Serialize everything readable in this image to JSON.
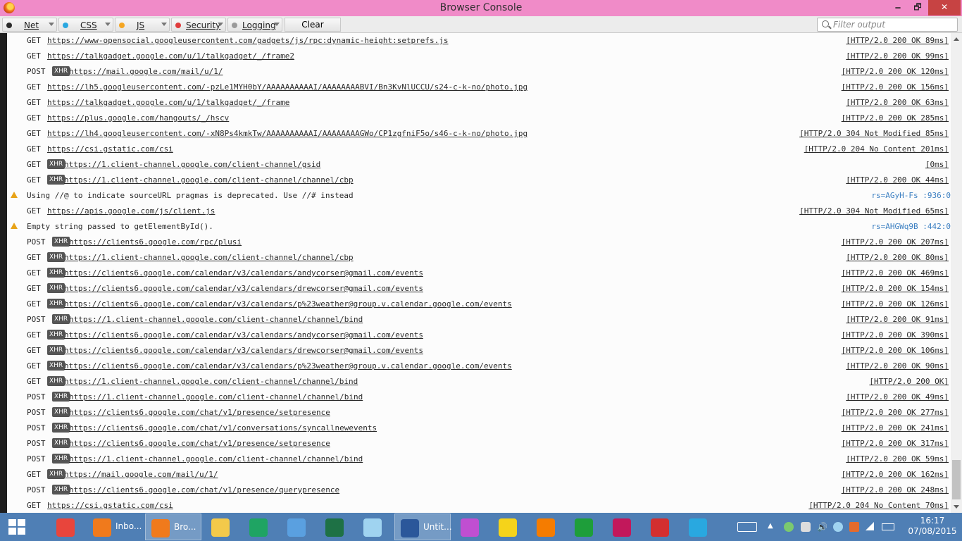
{
  "window": {
    "title": "Browser Console",
    "minimize": "🗕",
    "maximize": "🗗",
    "close": "✕"
  },
  "toolbar": {
    "filters": [
      {
        "label": "Net",
        "color": "#2a2a2a"
      },
      {
        "label": "CSS",
        "color": "#2aa7e0"
      },
      {
        "label": "JS",
        "color": "#f5a623"
      },
      {
        "label": "Security",
        "color": "#e03c3c"
      },
      {
        "label": "Logging",
        "color": "#9a9a9a"
      }
    ],
    "clear_label": "Clear",
    "filter_placeholder": "Filter output"
  },
  "rows": [
    {
      "method": "GET",
      "xhr": false,
      "url": "https://www-opensocial.googleusercontent.com/gadgets/js/rpc:dynamic-height:setprefs.js",
      "status": "[HTTP/2.0 200 OK 89ms]"
    },
    {
      "method": "GET",
      "xhr": false,
      "url": "https://talkgadget.google.com/u/1/talkgadget/_/frame2",
      "status": "[HTTP/2.0 200 OK 99ms]"
    },
    {
      "method": "POST",
      "xhr": true,
      "url": "https://mail.google.com/mail/u/1/",
      "status": "[HTTP/2.0 200 OK 120ms]"
    },
    {
      "method": "GET",
      "xhr": false,
      "url": "https://lh5.googleusercontent.com/-pzLe1MYH0bY/AAAAAAAAAAI/AAAAAAAABVI/Bn3KvNlUCCU/s24-c-k-no/photo.jpg",
      "status": "[HTTP/2.0 200 OK 156ms]"
    },
    {
      "method": "GET",
      "xhr": false,
      "url": "https://talkgadget.google.com/u/1/talkgadget/_/frame",
      "status": "[HTTP/2.0 200 OK 63ms]"
    },
    {
      "method": "GET",
      "xhr": false,
      "url": "https://plus.google.com/hangouts/_/hscv",
      "status": "[HTTP/2.0 200 OK 285ms]"
    },
    {
      "method": "GET",
      "xhr": false,
      "url": "https://lh4.googleusercontent.com/-xN8Ps4kmkTw/AAAAAAAAAAI/AAAAAAAAGWo/CP1zgfniF5o/s46-c-k-no/photo.jpg",
      "status": "[HTTP/2.0 304 Not Modified 85ms]"
    },
    {
      "method": "GET",
      "xhr": false,
      "url": "https://csi.gstatic.com/csi",
      "status": "[HTTP/2.0 204 No Content 201ms]"
    },
    {
      "method": "GET",
      "xhr": true,
      "url": "https://1.client-channel.google.com/client-channel/gsid",
      "status": "[0ms]"
    },
    {
      "method": "GET",
      "xhr": true,
      "url": "https://1.client-channel.google.com/client-channel/channel/cbp",
      "status": "[HTTP/2.0 200 OK 44ms]"
    },
    {
      "warning": true,
      "message": "Using //@ to indicate sourceURL pragmas is deprecated. Use //# instead",
      "source": "rs=AGyH-Fs :936:0"
    },
    {
      "method": "GET",
      "xhr": false,
      "url": "https://apis.google.com/js/client.js",
      "status": "[HTTP/2.0 304 Not Modified 65ms]"
    },
    {
      "warning": true,
      "message": "Empty string passed to getElementById().",
      "source": "rs=AHGWq9B :442:0"
    },
    {
      "method": "POST",
      "xhr": true,
      "url": "https://clients6.google.com/rpc/plusi",
      "status": "[HTTP/2.0 200 OK 207ms]"
    },
    {
      "method": "GET",
      "xhr": true,
      "url": "https://1.client-channel.google.com/client-channel/channel/cbp",
      "status": "[HTTP/2.0 200 OK 80ms]"
    },
    {
      "method": "GET",
      "xhr": true,
      "url": "https://clients6.google.com/calendar/v3/calendars/andycorser@gmail.com/events",
      "status": "[HTTP/2.0 200 OK 469ms]"
    },
    {
      "method": "GET",
      "xhr": true,
      "url": "https://clients6.google.com/calendar/v3/calendars/drewcorser@gmail.com/events",
      "status": "[HTTP/2.0 200 OK 154ms]"
    },
    {
      "method": "GET",
      "xhr": true,
      "url": "https://clients6.google.com/calendar/v3/calendars/p%23weather@group.v.calendar.google.com/events",
      "status": "[HTTP/2.0 200 OK 126ms]"
    },
    {
      "method": "POST",
      "xhr": true,
      "url": "https://1.client-channel.google.com/client-channel/channel/bind",
      "status": "[HTTP/2.0 200 OK 91ms]"
    },
    {
      "method": "GET",
      "xhr": true,
      "url": "https://clients6.google.com/calendar/v3/calendars/andycorser@gmail.com/events",
      "status": "[HTTP/2.0 200 OK 390ms]"
    },
    {
      "method": "GET",
      "xhr": true,
      "url": "https://clients6.google.com/calendar/v3/calendars/drewcorser@gmail.com/events",
      "status": "[HTTP/2.0 200 OK 106ms]"
    },
    {
      "method": "GET",
      "xhr": true,
      "url": "https://clients6.google.com/calendar/v3/calendars/p%23weather@group.v.calendar.google.com/events",
      "status": "[HTTP/2.0 200 OK 90ms]"
    },
    {
      "method": "GET",
      "xhr": true,
      "url": "https://1.client-channel.google.com/client-channel/channel/bind",
      "status": "[HTTP/2.0 200 OK]"
    },
    {
      "method": "POST",
      "xhr": true,
      "url": "https://1.client-channel.google.com/client-channel/channel/bind",
      "status": "[HTTP/2.0 200 OK 49ms]"
    },
    {
      "method": "POST",
      "xhr": true,
      "url": "https://clients6.google.com/chat/v1/presence/setpresence",
      "status": "[HTTP/2.0 200 OK 277ms]"
    },
    {
      "method": "POST",
      "xhr": true,
      "url": "https://clients6.google.com/chat/v1/conversations/syncallnewevents",
      "status": "[HTTP/2.0 200 OK 241ms]"
    },
    {
      "method": "POST",
      "xhr": true,
      "url": "https://clients6.google.com/chat/v1/presence/setpresence",
      "status": "[HTTP/2.0 200 OK 317ms]"
    },
    {
      "method": "POST",
      "xhr": true,
      "url": "https://1.client-channel.google.com/client-channel/channel/bind",
      "status": "[HTTP/2.0 200 OK 59ms]"
    },
    {
      "method": "GET",
      "xhr": true,
      "url": "https://mail.google.com/mail/u/1/",
      "status": "[HTTP/2.0 200 OK 162ms]"
    },
    {
      "method": "POST",
      "xhr": true,
      "url": "https://clients6.google.com/chat/v1/presence/querypresence",
      "status": "[HTTP/2.0 200 OK 248ms]"
    },
    {
      "method": "GET",
      "xhr": false,
      "url": "https://csi.gstatic.com/csi",
      "status": "[HTTP/2.0 204 No Content 70ms]"
    }
  ],
  "xhr_label": "XHR",
  "taskbar": {
    "items": [
      {
        "name": "chrome-icon",
        "color": "#e8453c",
        "label": ""
      },
      {
        "name": "firefox-inbox-icon",
        "color": "#f07a1c",
        "label": "Inbo..."
      },
      {
        "name": "firefox-browser-icon",
        "color": "#f07a1c",
        "label": "Bro...",
        "active": true
      },
      {
        "name": "file-explorer-icon",
        "color": "#f3c94a",
        "label": ""
      },
      {
        "name": "google-drive-icon",
        "color": "#1fa463",
        "label": ""
      },
      {
        "name": "control-panel-icon",
        "color": "#5aa0e0",
        "label": ""
      },
      {
        "name": "spreadsheet-icon",
        "color": "#1e7145",
        "label": ""
      },
      {
        "name": "notepad-icon",
        "color": "#9fd3f0",
        "label": ""
      },
      {
        "name": "document-icon",
        "color": "#2b579a",
        "label": "Untit...",
        "active": true
      },
      {
        "name": "picasa-icon",
        "color": "#c04fd1",
        "label": ""
      },
      {
        "name": "lightning-icon",
        "color": "#f5d31a",
        "label": ""
      },
      {
        "name": "media-player-icon",
        "color": "#f57c00",
        "label": ""
      },
      {
        "name": "store-icon",
        "color": "#1e9e3a",
        "label": ""
      },
      {
        "name": "music-app-icon",
        "color": "#c2185b",
        "label": ""
      },
      {
        "name": "acrobat-icon",
        "color": "#d32f2f",
        "label": ""
      },
      {
        "name": "mypeople-icon",
        "color": "#29a8e0",
        "label": ""
      }
    ],
    "time": "16:17",
    "date": "07/08/2015"
  }
}
